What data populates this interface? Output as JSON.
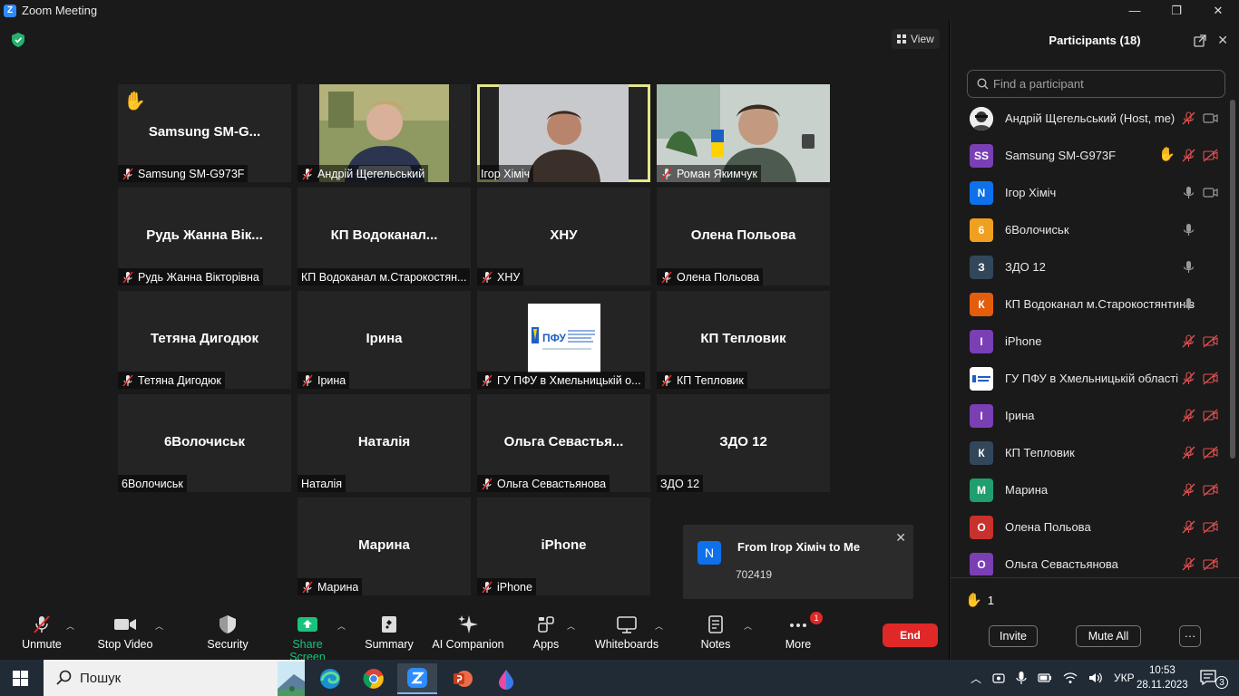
{
  "window": {
    "title": "Zoom Meeting",
    "controls": [
      "—",
      "❐",
      "✕"
    ]
  },
  "view_button": "View",
  "tiles": [
    {
      "big": "Samsung  SM-G...",
      "label": "Samsung SM-G973F",
      "muted": true,
      "hand": true
    },
    {
      "big": "",
      "label": "Андрій Щегельський",
      "muted": true,
      "video": "person-green"
    },
    {
      "big": "",
      "label": "Ігор Хіміч",
      "muted": false,
      "video": "person-grey",
      "active": true
    },
    {
      "big": "",
      "label": "Роман Якимчук",
      "muted": true,
      "video": "person-office"
    },
    {
      "big": "Рудь  Жанна  Вік...",
      "label": "Рудь Жанна Вікторівна",
      "muted": true
    },
    {
      "big": "КП  Водоканал...",
      "label": "КП Водоканал м.Старокостян...",
      "muted": false
    },
    {
      "big": "ХНУ",
      "label": "ХНУ",
      "muted": true
    },
    {
      "big": "Олена Польова",
      "label": "Олена Польова",
      "muted": true
    },
    {
      "big": "Тетяна Дигодюк",
      "label": "Тетяна Дигодюк",
      "muted": true
    },
    {
      "big": "Ірина",
      "label": "Ірина",
      "muted": true
    },
    {
      "big": "",
      "label": "ГУ ПФУ в Хмельницькій о...",
      "muted": true,
      "logo": "ПФУ"
    },
    {
      "big": "КП Тепловик",
      "label": "КП Тепловик",
      "muted": true
    },
    {
      "big": "6Волочиськ",
      "label": "6Волочиськ",
      "muted": false
    },
    {
      "big": "Наталія",
      "label": "Наталія",
      "muted": false
    },
    {
      "big": "Ольга  Севастья...",
      "label": "Ольга Севастьянова",
      "muted": true
    },
    {
      "big": "ЗДО 12",
      "label": "ЗДО 12",
      "muted": false
    },
    {
      "big": "Марина",
      "label": "Марина",
      "muted": true
    },
    {
      "big": "iPhone",
      "label": "iPhone",
      "muted": true
    }
  ],
  "toast": {
    "avatar": "N",
    "title": "From Ігор Хіміч to Me",
    "message": "702419"
  },
  "toolbar": {
    "unmute": "Unmute",
    "stop_video": "Stop Video",
    "security": "Security",
    "share_screen": "Share Screen",
    "summary": "Summary",
    "ai_companion": "AI Companion",
    "apps": "Apps",
    "whiteboards": "Whiteboards",
    "notes": "Notes",
    "more": "More",
    "more_badge": "1",
    "end": "End"
  },
  "panel": {
    "title": "Participants (18)",
    "search_placeholder": "Find a participant",
    "participants": [
      {
        "avatar": "",
        "avatar_color": "#dddddd",
        "name": "Андрій Щегельський (Host, me)",
        "mic": "muted",
        "video": "on",
        "photo": true
      },
      {
        "avatar": "SS",
        "avatar_color": "#7b3fb5",
        "name": "Samsung SM-G973F",
        "mic": "muted",
        "video": "off",
        "hand": true
      },
      {
        "avatar": "N",
        "avatar_color": "#0e71eb",
        "name": "Ігор Хіміч",
        "mic": "on",
        "video": "on"
      },
      {
        "avatar": "6",
        "avatar_color": "#f0a01e",
        "name": "6Волочиськ",
        "mic": "on",
        "video": "none"
      },
      {
        "avatar": "З",
        "avatar_color": "#33475b",
        "name": "ЗДО 12",
        "mic": "on",
        "video": "none"
      },
      {
        "avatar": "К",
        "avatar_color": "#e35d0c",
        "name": "КП Водоканал м.Старокостянтинів",
        "mic": "on",
        "video": "none"
      },
      {
        "avatar": "I",
        "avatar_color": "#7b3fb5",
        "name": "iPhone",
        "mic": "muted",
        "video": "off"
      },
      {
        "avatar": "",
        "avatar_color": "#ffffff",
        "name": "ГУ ПФУ в Хмельницькій області",
        "mic": "muted",
        "video": "off",
        "logo": true
      },
      {
        "avatar": "І",
        "avatar_color": "#7b3fb5",
        "name": "Ірина",
        "mic": "muted",
        "video": "off"
      },
      {
        "avatar": "К",
        "avatar_color": "#33475b",
        "name": "КП Тепловик",
        "mic": "muted",
        "video": "off"
      },
      {
        "avatar": "М",
        "avatar_color": "#1f9e6e",
        "name": "Марина",
        "mic": "muted",
        "video": "off"
      },
      {
        "avatar": "О",
        "avatar_color": "#c8322c",
        "name": "Олена Польова",
        "mic": "muted",
        "video": "off"
      },
      {
        "avatar": "О",
        "avatar_color": "#7b3fb5",
        "name": "Ольга Севастьянова",
        "mic": "muted",
        "video": "off"
      }
    ],
    "raised_hands": "1",
    "invite": "Invite",
    "mute_all": "Mute All",
    "more": "···"
  },
  "taskbar": {
    "search_text": "Пошук",
    "language": "УКР",
    "time": "10:53",
    "date": "28.11.2023",
    "notifications": "3"
  },
  "colors": {
    "accent": "#0e71eb",
    "end": "#e02828",
    "share": "#19c37d",
    "active_border": "#e4e68c",
    "muted": "#e02828"
  }
}
